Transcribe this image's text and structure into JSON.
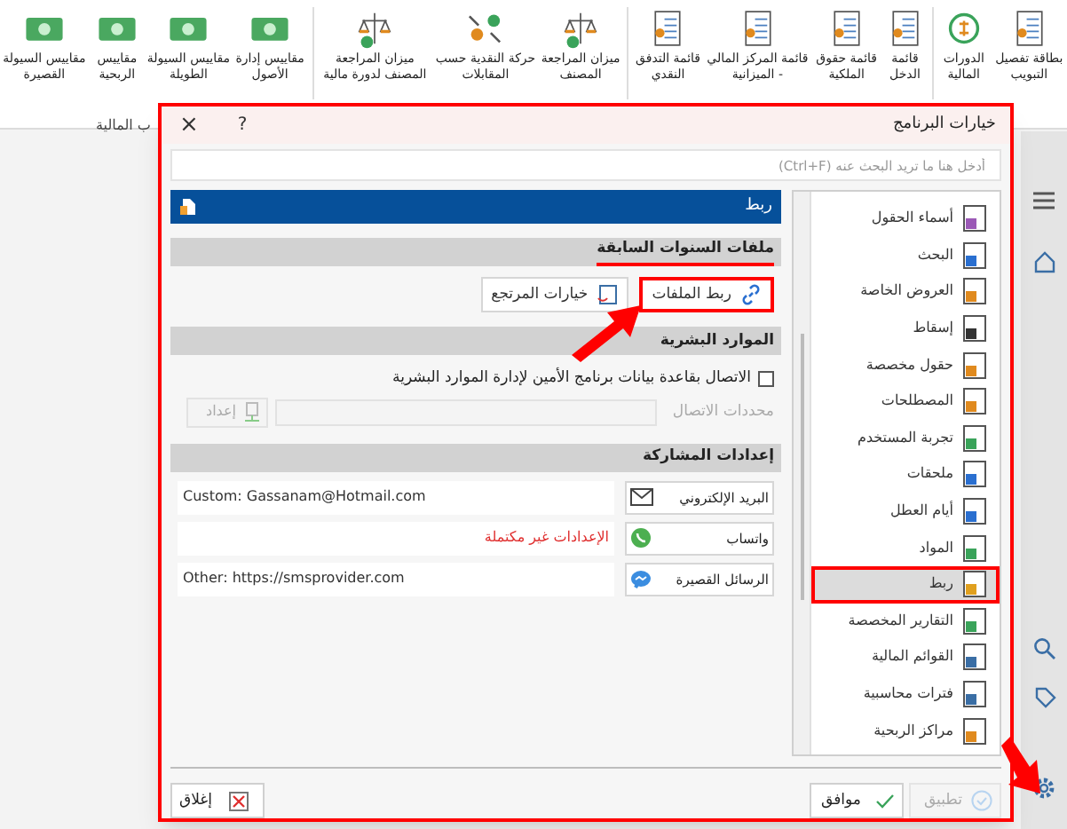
{
  "ribbon": {
    "groups": [
      {
        "items": [
          "بطاقة تفصيل التبويب",
          "الدورات المالية"
        ]
      },
      {
        "items": [
          "قائمة الدخل",
          "قائمة حقوق الملكية",
          "قائمة المركز المالي - الميزانية",
          "قائمة التدفق النقدي"
        ]
      },
      {
        "items": [
          "ميزان المراجعة المصنف",
          "حركة النقدية حسب المقابلات",
          "ميزان المراجعة المصنف لدورة مالية"
        ]
      },
      {
        "items": [
          "مقاييس إدارة الأصول",
          "مقاييس السيولة الطويلة",
          "مقاييس الربحية",
          "مقاييس السيولة القصيرة"
        ]
      }
    ],
    "group_label": "ب المالية"
  },
  "dialog": {
    "title": "خيارات البرنامج",
    "help": "?",
    "close": "×",
    "highlighted": true,
    "search": {
      "placeholder": "أدخل هنا ما تريد البحث عنه (Ctrl+F)"
    },
    "panel_title": "ربط",
    "prev_years": {
      "title": "ملفات السنوات السابقة",
      "highlighted": true,
      "buttons": [
        {
          "label": "ربط الملفات",
          "highlighted": true
        },
        {
          "label": "خيارات المرتجع",
          "highlighted": false
        }
      ]
    },
    "hr": {
      "title": "الموارد البشرية",
      "checkbox": {
        "label": "الاتصال بقاعدة بيانات برنامج الأمين لإدارة الموارد البشرية",
        "checked": false
      },
      "connection": {
        "label": "محددات الاتصال",
        "button": "إعداد",
        "disabled": true
      }
    },
    "sharing": {
      "title": "إعدادات المشاركة",
      "rows": [
        {
          "kind": "email",
          "button": "البريد الإلكتروني",
          "value": "Custom: Gassanam@Hotmail.com",
          "incomplete": false
        },
        {
          "kind": "whatsapp",
          "button": "واتساب",
          "value": "الإعدادات غير مكتملة",
          "incomplete": true
        },
        {
          "kind": "sms",
          "button": "الرسائل القصيرة",
          "value": "Other: https://smsprovider.com",
          "incomplete": false
        }
      ]
    },
    "categories": [
      {
        "label": "أسماء الحقول",
        "selected": false
      },
      {
        "label": "البحث",
        "selected": false
      },
      {
        "label": "العروض الخاصة",
        "selected": false
      },
      {
        "label": "إسقاط",
        "selected": false
      },
      {
        "label": "حقول مخصصة",
        "selected": false
      },
      {
        "label": "المصطلحات",
        "selected": false
      },
      {
        "label": "تجربة المستخدم",
        "selected": false
      },
      {
        "label": "ملحقات",
        "selected": false
      },
      {
        "label": "أيام العطل",
        "selected": false
      },
      {
        "label": "المواد",
        "selected": false
      },
      {
        "label": "ربط",
        "selected": true
      },
      {
        "label": "التقارير المخصصة",
        "selected": false
      },
      {
        "label": "القوائم المالية",
        "selected": false
      },
      {
        "label": "فترات محاسبية",
        "selected": false
      },
      {
        "label": "مراكز الربحية",
        "selected": false
      }
    ],
    "footer": {
      "apply": {
        "label": "تطبيق",
        "disabled": true
      },
      "ok": "موافق",
      "close": "إغلاق"
    }
  }
}
